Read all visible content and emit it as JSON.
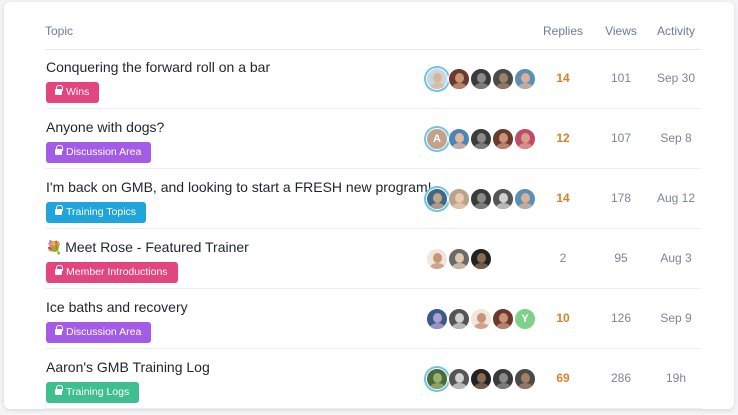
{
  "header": {
    "topic": "Topic",
    "replies": "Replies",
    "views": "Views",
    "activity": "Activity"
  },
  "colors": {
    "replies_hot": "#d9822b",
    "replies_normal": "#7c8597"
  },
  "topics": [
    {
      "title": "Conquering the forward roll on a bar",
      "emoji": "",
      "category": "Wins",
      "category_color": "#e3457e",
      "replies": "14",
      "views": "101",
      "activity": "Sep 30",
      "hot": true,
      "avatars": [
        {
          "skin": "#d9b69a",
          "bg": "#c9d5e0",
          "ring": true
        },
        {
          "skin": "#c89478",
          "bg": "#6b3a2c"
        },
        {
          "skin": "#8a8a8a",
          "bg": "#3b3b3b"
        },
        {
          "skin": "#a08068",
          "bg": "#4a4a4a"
        },
        {
          "skin": "#d8b09a",
          "bg": "#5b8fb3"
        }
      ]
    },
    {
      "title": "Anyone with dogs?",
      "emoji": "",
      "category": "Discussion Area",
      "category_color": "#a35ce6",
      "replies": "12",
      "views": "107",
      "activity": "Sep 8",
      "hot": true,
      "avatars": [
        {
          "letter": "A",
          "bg": "#c4a28a",
          "ring": true
        },
        {
          "skin": "#e0b8a0",
          "bg": "#4c86b8"
        },
        {
          "skin": "#8a8a8a",
          "bg": "#3b3b3b"
        },
        {
          "skin": "#c89478",
          "bg": "#6b3a2c"
        },
        {
          "skin": "#d4a08c",
          "bg": "#c04a6a"
        }
      ]
    },
    {
      "title": "I'm back on GMB, and looking to start a FRESH new program!",
      "emoji": "",
      "category": "Training Topics",
      "category_color": "#1fa5dc",
      "replies": "14",
      "views": "178",
      "activity": "Aug 12",
      "hot": true,
      "avatars": [
        {
          "skin": "#c8a484",
          "bg": "#3e6a8a",
          "ring": true
        },
        {
          "skin": "#e6cbb0",
          "bg": "#b8a48a"
        },
        {
          "skin": "#8a8a8a",
          "bg": "#3b3b3b"
        },
        {
          "skin": "#d0d0d0",
          "bg": "#555555"
        },
        {
          "skin": "#d8b09a",
          "bg": "#5b8fb3"
        }
      ]
    },
    {
      "title": "Meet Rose - Featured Trainer",
      "emoji": "💐",
      "category": "Member Introductions",
      "category_color": "#e3457e",
      "replies": "2",
      "views": "95",
      "activity": "Aug 3",
      "hot": false,
      "avatars": [
        {
          "skin": "#c89478",
          "bg": "#f0e6dc"
        },
        {
          "skin": "#e0c8b0",
          "bg": "#6a6a6a"
        },
        {
          "skin": "#8a6a50",
          "bg": "#222222"
        }
      ]
    },
    {
      "title": "Ice baths and recovery",
      "emoji": "",
      "category": "Discussion Area",
      "category_color": "#a35ce6",
      "replies": "10",
      "views": "126",
      "activity": "Sep 9",
      "hot": true,
      "avatars": [
        {
          "skin": "#b0a0d0",
          "bg": "#3a5a8a"
        },
        {
          "skin": "#d0d0d0",
          "bg": "#555555"
        },
        {
          "skin": "#c89478",
          "bg": "#f0e6dc"
        },
        {
          "skin": "#c89478",
          "bg": "#6b3a2c"
        },
        {
          "letter": "Y",
          "bg": "#7fd18a"
        }
      ]
    },
    {
      "title": "Aaron's GMB Training Log",
      "emoji": "",
      "category": "Training Logs",
      "category_color": "#3fbf8f",
      "replies": "69",
      "views": "286",
      "activity": "19h",
      "hot": true,
      "avatars": [
        {
          "skin": "#9ab070",
          "bg": "#4a6a3a",
          "ring": true
        },
        {
          "skin": "#d0d0d0",
          "bg": "#555555"
        },
        {
          "skin": "#8a6a50",
          "bg": "#222222"
        },
        {
          "skin": "#8a8a8a",
          "bg": "#3b3b3b"
        },
        {
          "skin": "#a08068",
          "bg": "#4a4a4a"
        }
      ]
    }
  ]
}
